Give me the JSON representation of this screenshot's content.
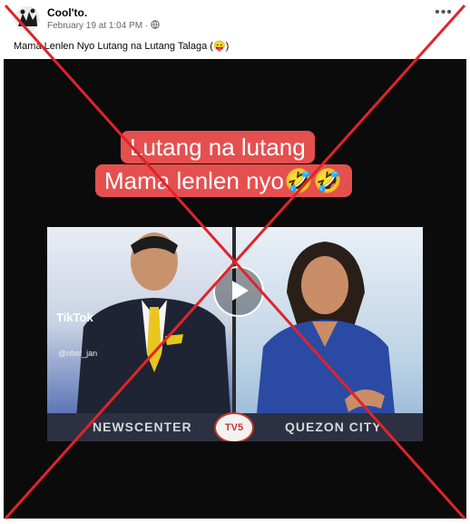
{
  "post": {
    "author": "Cool'to.",
    "timestamp": "February 19 at 1:04 PM",
    "separator": "·",
    "privacy_icon": "globe-icon",
    "more_label": "•••",
    "caption": "Mama Lenlen Nyo Lutang na Lutang Talaga (😛)"
  },
  "video": {
    "title_line1": "Lutang na lutang",
    "title_line2": "Mama lenlen nyo🤣🤣",
    "watermark": "TikTok",
    "watermark_handle": "@nbel_jan",
    "lower_left": "NEWSCENTER",
    "lower_right": "QUEZON CITY",
    "logo_text": "TV5",
    "play_icon": "play-icon"
  },
  "overlay": {
    "mark_color": "#e0242b"
  }
}
